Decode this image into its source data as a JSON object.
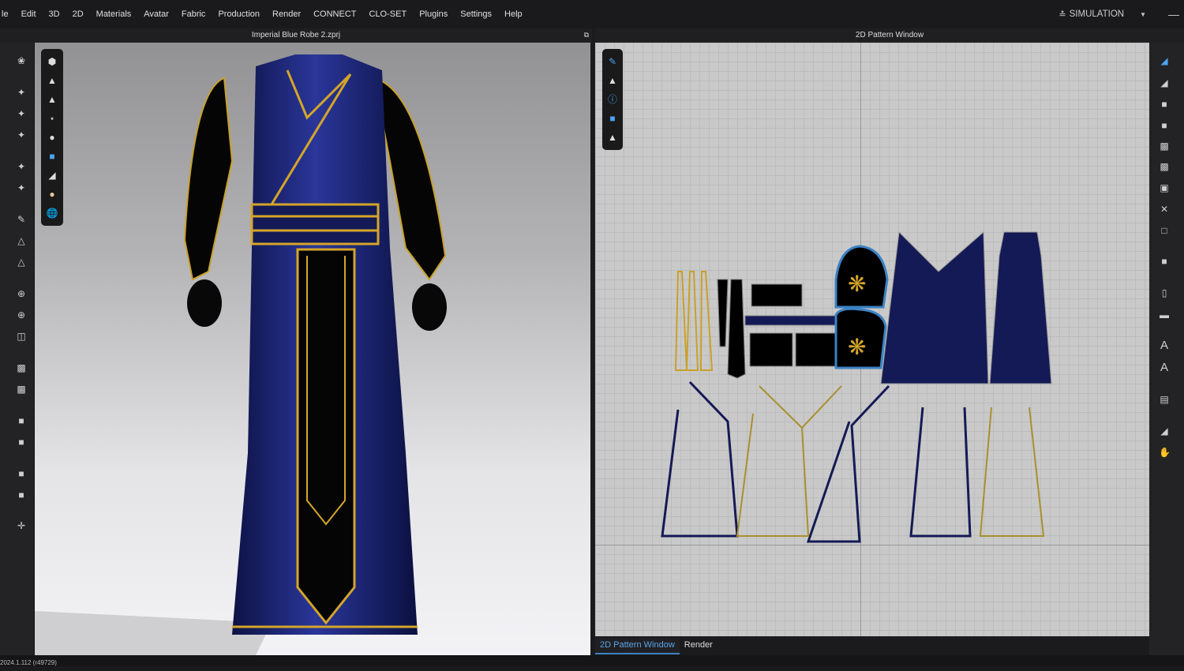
{
  "menu": [
    "le",
    "Edit",
    "3D",
    "2D",
    "Materials",
    "Avatar",
    "Fabric",
    "Production",
    "Render",
    "CONNECT",
    "CLO-SET",
    "Plugins",
    "Settings",
    "Help"
  ],
  "simulation": {
    "label": "SIMULATION",
    "icon": "double-chevron-down-icon"
  },
  "viewport3d": {
    "title": "Imperial Blue Robe 2.zprj"
  },
  "pattern2d": {
    "title": "2D Pattern Window"
  },
  "tabs": [
    {
      "label": "2D Pattern Window",
      "active": true
    },
    {
      "label": "Render",
      "active": false
    }
  ],
  "status": {
    "version": "2024.1.112 (r49729)"
  },
  "colors": {
    "robe": "#141a55",
    "gold": "#d4a52a",
    "accent": "#3b82c4"
  }
}
